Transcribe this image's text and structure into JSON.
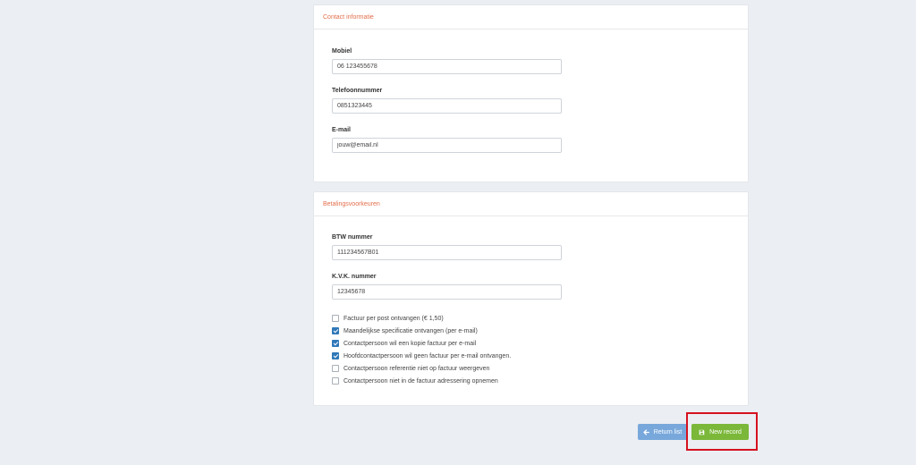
{
  "contact": {
    "title": "Contact informatie",
    "fields": [
      {
        "label": "Mobiel",
        "value": "06 123455678"
      },
      {
        "label": "Telefoonnummer",
        "value": "0851323445"
      },
      {
        "label": "E-mail",
        "value": "jouw@email.nl"
      }
    ]
  },
  "payment": {
    "title": "Betalingsvoorkeuren",
    "fields": [
      {
        "label": "BTW nummer",
        "value": "111234567B01"
      },
      {
        "label": "K.V.K. nummer",
        "value": "12345678"
      }
    ],
    "options": [
      {
        "label": "Factuur per post ontvangen (€ 1,50)",
        "checked": false
      },
      {
        "label": "Maandelijkse specificatie ontvangen (per e-mail)",
        "checked": true
      },
      {
        "label": "Contactpersoon wil een kopie factuur per e-mail",
        "checked": true
      },
      {
        "label": "Hoofdcontactpersoon wil geen factuur per e-mail ontvangen.",
        "checked": true
      },
      {
        "label": "Contactpersoon referentie niet op factuur weergeven",
        "checked": false
      },
      {
        "label": "Contactpersoon niet in de factuur adressering opnemen",
        "checked": false
      }
    ]
  },
  "actions": {
    "return_label": "Return list",
    "new_record_label": "New record"
  },
  "icons": {
    "return": "arrow-left-icon",
    "new_record": "floppy-disk-icon"
  },
  "colors": {
    "accent_title": "#e36e4c",
    "return_button": "#78a8db",
    "new_record_button": "#7bb83a",
    "checkbox_checked": "#2f78b8",
    "highlight": "#d6121f"
  }
}
